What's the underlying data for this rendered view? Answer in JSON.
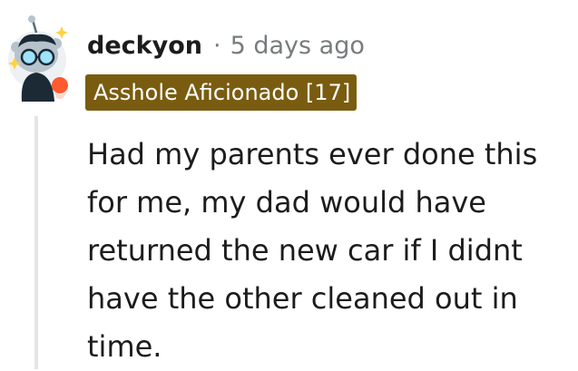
{
  "comment": {
    "author": "deckyon",
    "separator": "·",
    "timestamp": "5 days ago",
    "flair": "Asshole Aficionado [17]",
    "body": "Had my parents ever done this for me, my dad would have returned the new car if I didnt have the other cleaned out in time.",
    "avatar_icon": "snoo-avatar-icon"
  },
  "colors": {
    "flair_background": "#7a5c10",
    "flair_text": "#ffffff",
    "meta_text": "#787c7e",
    "body_text": "#1c1c1c",
    "thread_line": "#e5e5e5"
  }
}
